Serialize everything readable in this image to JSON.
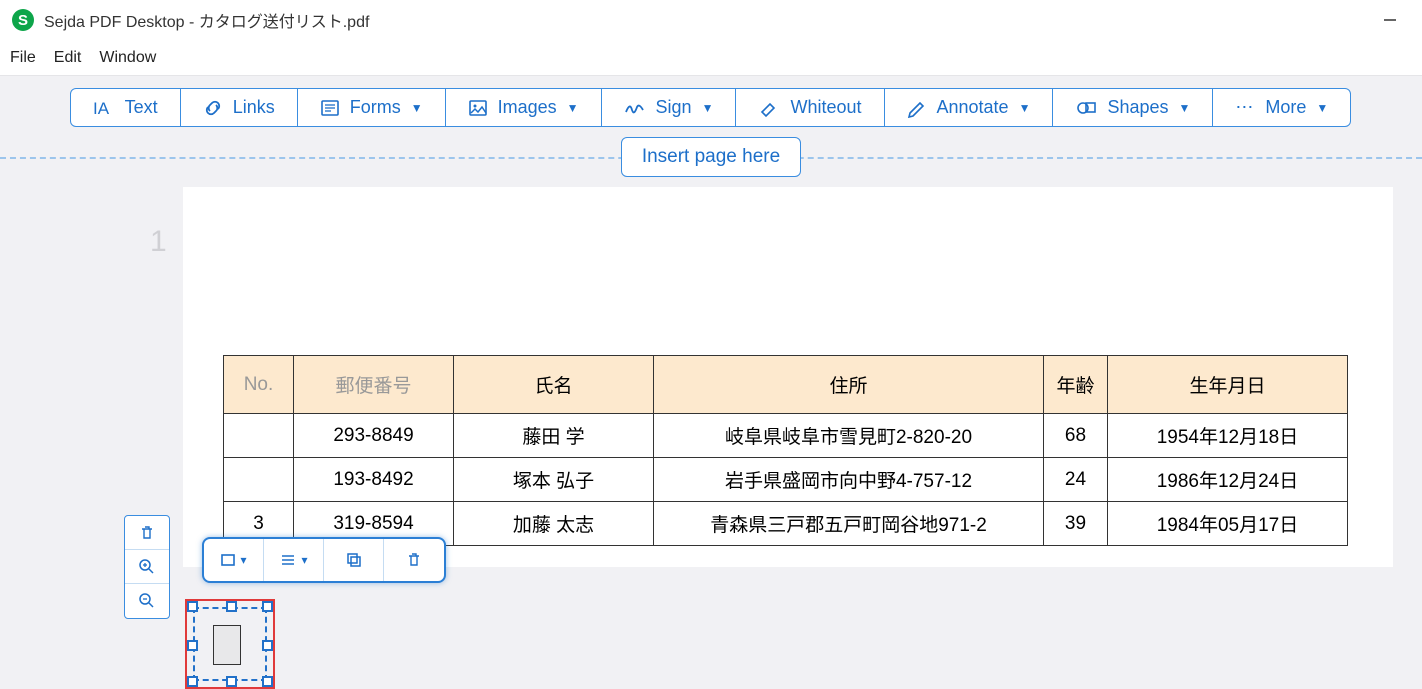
{
  "title": "Sejda PDF Desktop - カタログ送付リスト.pdf",
  "menubar": {
    "file": "File",
    "edit": "Edit",
    "window": "Window"
  },
  "toolbar": {
    "text": "Text",
    "links": "Links",
    "forms": "Forms",
    "images": "Images",
    "sign": "Sign",
    "whiteout": "Whiteout",
    "annotate": "Annotate",
    "shapes": "Shapes",
    "more": "More"
  },
  "insert_label": "Insert page here",
  "page_number": "1",
  "table": {
    "headers": {
      "no": "No.",
      "zip": "郵便番号",
      "name": "氏名",
      "addr": "住所",
      "age": "年齢",
      "dob": "生年月日"
    },
    "rows": [
      {
        "no": "",
        "zip": "293-8849",
        "name": "藤田 学",
        "addr": "岐阜県岐阜市雪見町2-820-20",
        "age": "68",
        "dob": "1954年12月18日"
      },
      {
        "no": "",
        "zip": "193-8492",
        "name": "塚本 弘子",
        "addr": "岩手県盛岡市向中野4-757-12",
        "age": "24",
        "dob": "1986年12月24日"
      },
      {
        "no": "3",
        "zip": "319-8594",
        "name": "加藤 太志",
        "addr": "青森県三戸郡五戸町岡谷地971-2",
        "age": "39",
        "dob": "1984年05月17日"
      }
    ]
  }
}
